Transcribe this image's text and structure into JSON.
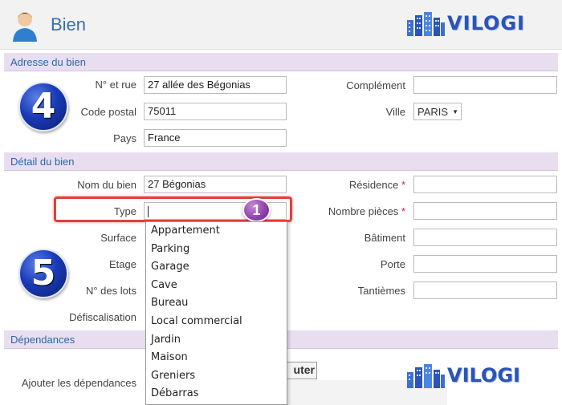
{
  "header": {
    "title": "Bien",
    "brand": "VILOGI"
  },
  "sections": {
    "address": {
      "title": "Adresse du bien"
    },
    "detail": {
      "title": "Détail du bien"
    },
    "dependencies": {
      "title": "Dépendances"
    }
  },
  "badges": {
    "address_step": "4",
    "detail_step": "5",
    "type_marker": "1"
  },
  "address": {
    "street_label": "N° et rue",
    "street_value": "27 allée des Bégonias",
    "postal_label": "Code postal",
    "postal_value": "75011",
    "country_label": "Pays",
    "country_value": "France",
    "complement_label": "Complément",
    "complement_value": "",
    "city_label": "Ville",
    "city_value": "PARIS"
  },
  "detail": {
    "name_label": "Nom du bien",
    "name_value": "27 Bégonias",
    "type_label": "Type",
    "type_value": "",
    "surface_label": "Surface",
    "floor_label": "Etage",
    "lots_label": "N° des lots",
    "defisc_label": "Défiscalisation",
    "residence_label": "Résidence",
    "rooms_label": "Nombre pièces",
    "building_label": "Bâtiment",
    "door_label": "Porte",
    "shares_label": "Tantièmes",
    "required_mark": "*"
  },
  "type_options": [
    "Appartement",
    "Parking",
    "Garage",
    "Cave",
    "Bureau",
    "Local commercial",
    "Jardin",
    "Maison",
    "Greniers",
    "Débarras"
  ],
  "dependencies": {
    "add_label": "Ajouter les dépendances",
    "add_button": "uter"
  },
  "colors": {
    "section_bg": "#e9deef",
    "section_text": "#2b67a8",
    "highlight": "#e0413c",
    "marker": "#8e3fa8",
    "brand": "#2b53b8"
  }
}
